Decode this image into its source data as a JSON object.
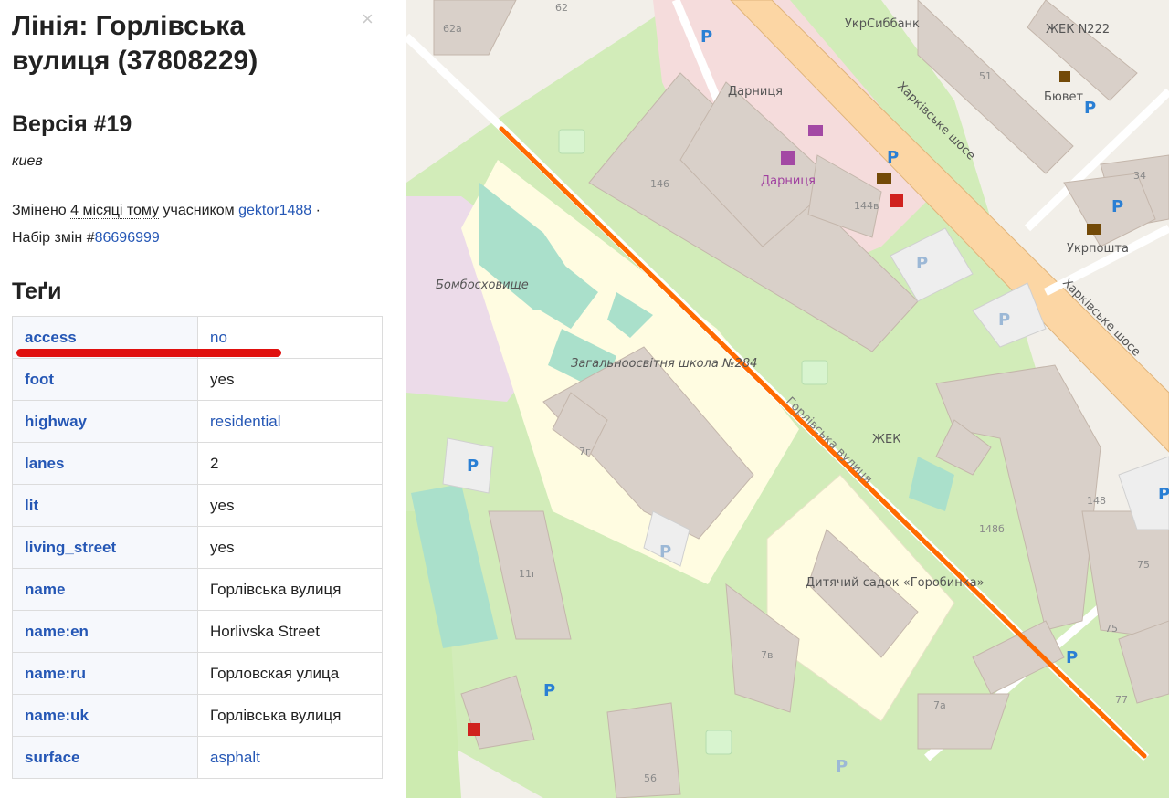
{
  "sidebar": {
    "title": "Лінія: Горлівська вулиця (37808229)",
    "close_symbol": "×",
    "version": "Версія #19",
    "comment": "киев",
    "changed_prefix": "Змінено",
    "changed_time": "4 місяці тому",
    "changed_by_word": "учасником",
    "user": "gektor1488",
    "separator": "·",
    "changeset_prefix": "Набір змін #",
    "changeset_id": "86696999",
    "tags_heading": "Теґи",
    "tags": [
      {
        "key": "access",
        "value": "no",
        "link": true
      },
      {
        "key": "foot",
        "value": "yes",
        "link": false
      },
      {
        "key": "highway",
        "value": "residential",
        "link": true
      },
      {
        "key": "lanes",
        "value": "2",
        "link": false
      },
      {
        "key": "lit",
        "value": "yes",
        "link": false
      },
      {
        "key": "living_street",
        "value": "yes",
        "link": false
      },
      {
        "key": "name",
        "value": "Горлівська вулиця",
        "link": false
      },
      {
        "key": "name:en",
        "value": "Horlivska Street",
        "link": false
      },
      {
        "key": "name:ru",
        "value": "Горловская улица",
        "link": false
      },
      {
        "key": "name:uk",
        "value": "Горлівська вулиця",
        "link": false
      },
      {
        "key": "surface",
        "value": "asphalt",
        "link": true
      }
    ]
  },
  "map": {
    "labels": {
      "kharkiv_highway_1": "Харківське шосе",
      "kharkiv_highway_2": "Харківське шосе",
      "horlivska_street": "Горлівська вулиця",
      "ukrsibbank": "УкрСиббанк",
      "darnytsia_1": "Дарниця",
      "darnytsia_2": "Дарниця",
      "zhek_n222": "ЖЕК N222",
      "zhek": "ЖЕК",
      "buvet": "Бювет",
      "ukrposhta": "Укрпошта",
      "bomb_shelter": "Бомбосховище",
      "school": "Загальноосвітня школа №284",
      "kindergarten": "Дитячий садок «Горобинка»",
      "house_62": "62",
      "house_62a": "62а",
      "house_51": "51",
      "house_146": "146",
      "house_144v": "144в",
      "house_34": "34",
      "house_7g": "7г",
      "house_148": "148",
      "house_148b": "148б",
      "house_11g": "11г",
      "house_7v": "7в",
      "house_75a": "75",
      "house_75b": "75",
      "house_77": "77",
      "house_7a": "7а",
      "house_56": "56",
      "parking": "P"
    },
    "colors": {
      "background": "#f2efe9",
      "highway": "#fcd6a4",
      "selected_way": "#ff6a00",
      "park": "#c8facc",
      "school": "#fffce1",
      "building": "#d9d0c9",
      "commercial": "#f5dcdc",
      "pitch": "#aae0cb",
      "military": "#f1dbee"
    }
  }
}
